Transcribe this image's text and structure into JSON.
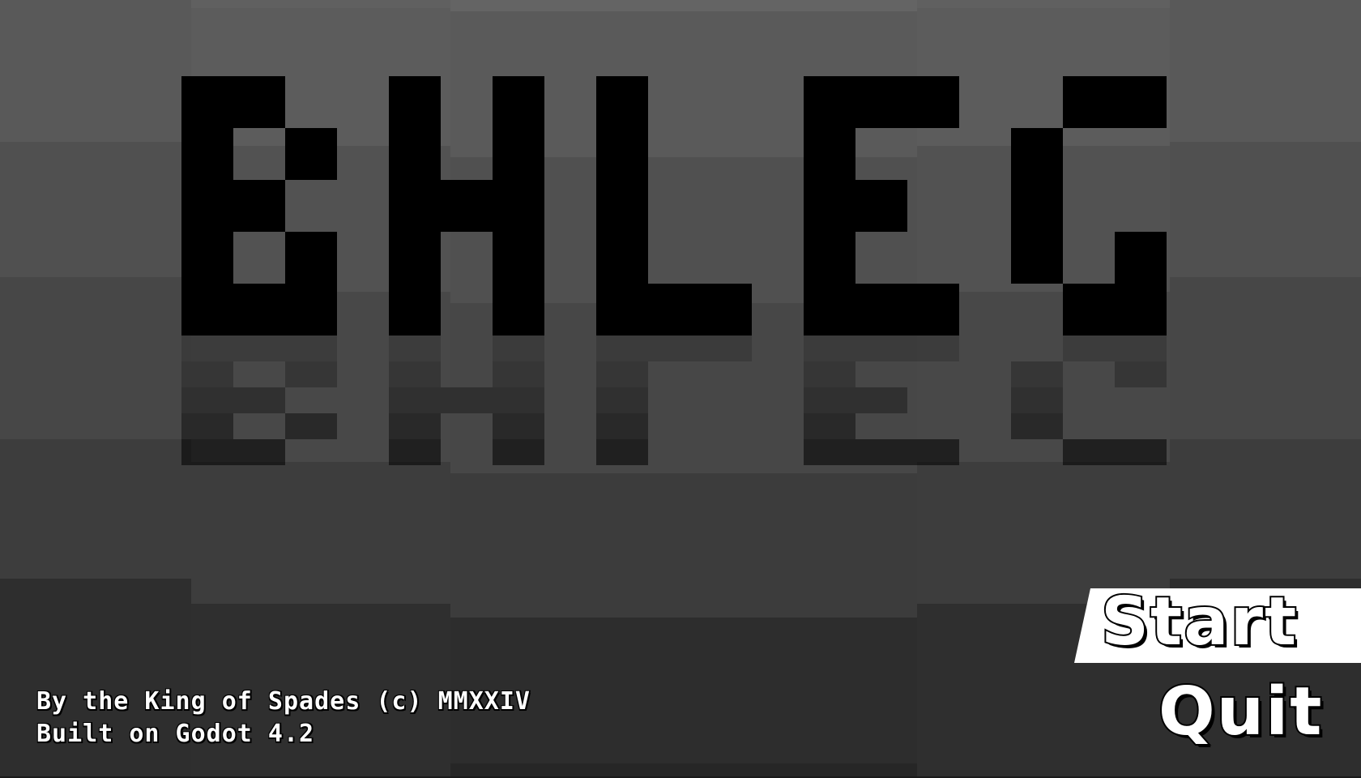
{
  "title": "BHLEG",
  "menu": {
    "start_label": "Start",
    "quit_label": "Quit"
  },
  "credits": {
    "line1": "By the King of Spades (c) MMXXIV",
    "line2": "Built on Godot 4.2"
  },
  "colors": {
    "background": "#3a3a3a",
    "logo": "#000000",
    "start_highlight": "#ffffff",
    "text": "#ffffff"
  }
}
